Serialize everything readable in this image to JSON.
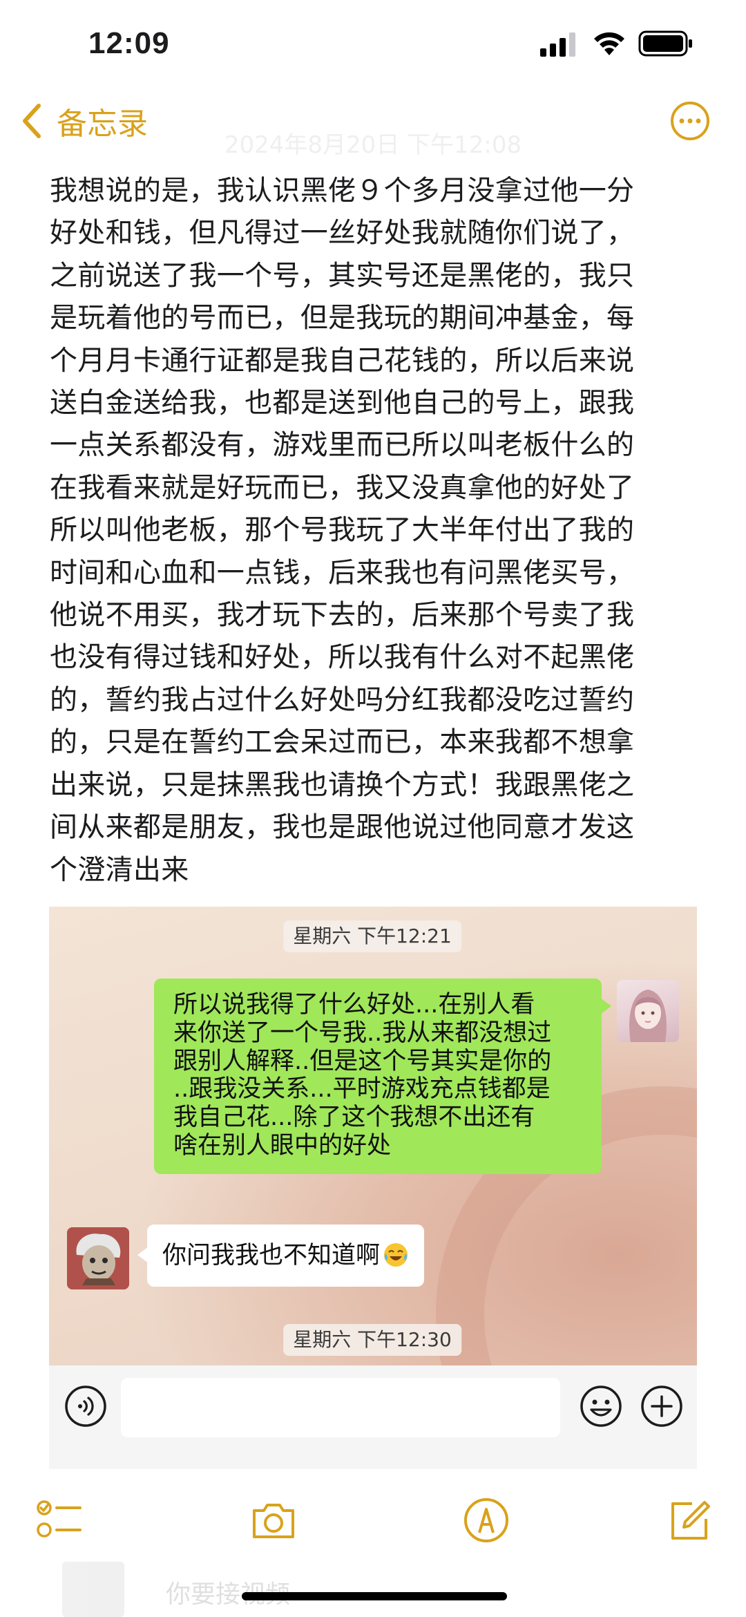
{
  "status_bar": {
    "time": "12:09"
  },
  "nav": {
    "back_label": "备忘录",
    "date": "2024年8月20日 下午12:08"
  },
  "note": {
    "lines": [
      "我想说的是，我认识黑佬９个多月没拿过他一分",
      "好处和钱，但凡得过一丝好处我就随你们说了，",
      "之前说送了我一个号，其实号还是黑佬的，我只",
      "是玩着他的号而已，但是我玩的期间冲基金，每",
      "个月月卡通行证都是我自己花钱的，所以后来说",
      "送白金送给我，也都是送到他自己的号上，跟我",
      "一点关系都没有，游戏里而已所以叫老板什么的",
      "在我看来就是好玩而已，我又没真拿他的好处了",
      "所以叫他老板，那个号我玩了大半年付出了我的",
      "时间和心血和一点钱，后来我也有问黑佬买号，",
      "他说不用买，我才玩下去的，后来那个号卖了我",
      "也没有得过钱和好处，所以我有什么对不起黑佬",
      "的，誓约我占过什么好处吗分红我都没吃过誓约",
      "的，只是在誓约工会呆过而已，本来我都不想拿",
      "出来说，只是抹黑我也请换个方式！我跟黑佬之",
      "间从来都是朋友，我也是跟他说过他同意才发这",
      "个澄清出来"
    ]
  },
  "chat": {
    "time_1": "星期六 下午12:21",
    "outgoing_lines": [
      "所以说我得了什么好处...在别人看",
      "来你送了一个号我..我从来都没想过",
      "跟别人解释..但是这个号其实是你的",
      "..跟我没关系...平时游戏充点钱都是",
      "我自己花...除了这个我想不出还有",
      "啥在别人眼中的好处"
    ],
    "incoming_text": "你问我我也不知道啊",
    "time_2": "星期六 下午12:30",
    "input_value": ""
  },
  "ghost": {
    "text": "你要接视频"
  },
  "colors": {
    "accent": "#d9a21b",
    "wechat_green": "#a0e75a",
    "bubble_white": "#ffffff"
  },
  "icons": {
    "back": "chevron-left-icon",
    "more": "ellipsis-circle-icon",
    "checklist": "checklist-icon",
    "camera": "camera-icon",
    "markup": "pen-circle-icon",
    "compose": "compose-icon"
  }
}
